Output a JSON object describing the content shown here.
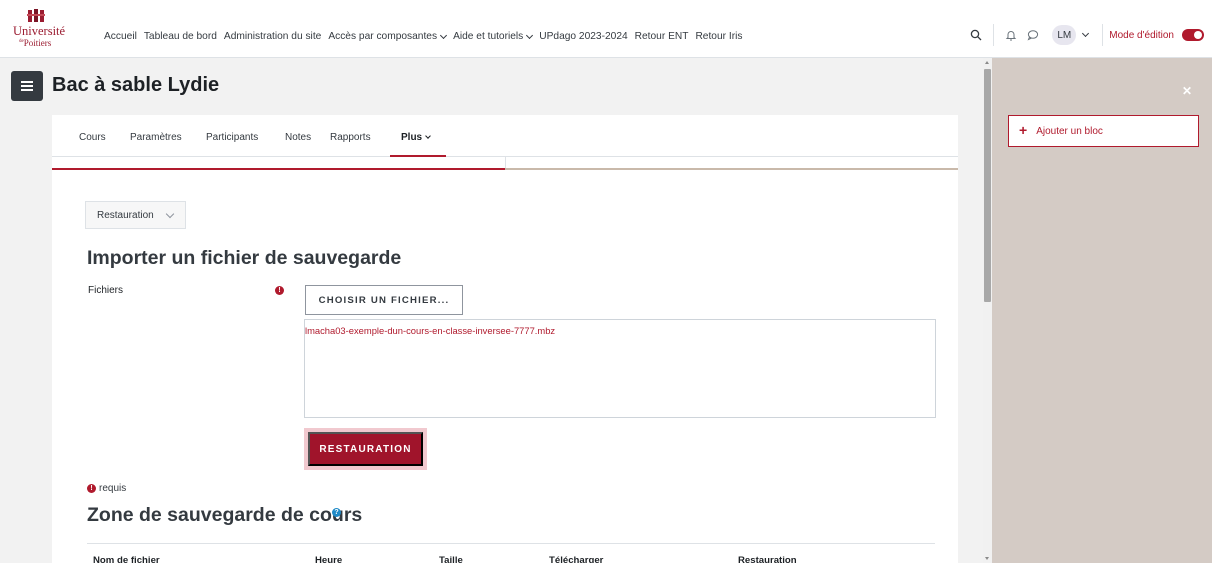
{
  "logo": {
    "line1": "Université",
    "line2": "Poitiers",
    "line2_prefix": "de"
  },
  "nav": {
    "items": [
      {
        "label": "Accueil",
        "dropdown": false
      },
      {
        "label": "Tableau de bord",
        "dropdown": false
      },
      {
        "label": "Administration du site",
        "dropdown": false
      },
      {
        "label": "Accès par composantes",
        "dropdown": true
      },
      {
        "label": "Aide et tutoriels",
        "dropdown": true
      },
      {
        "label": "UPdago 2023-2024",
        "dropdown": false
      },
      {
        "label": "Retour ENT",
        "dropdown": false
      },
      {
        "label": "Retour Iris",
        "dropdown": false
      }
    ],
    "user_initials": "LM",
    "edit_mode_label": "Mode d'édition",
    "icons": [
      "search-icon",
      "bell-icon",
      "chat-icon"
    ]
  },
  "page": {
    "title": "Bac à sable Lydie"
  },
  "tabs": {
    "items": [
      "Cours",
      "Paramètres",
      "Participants",
      "Notes",
      "Rapports",
      "Plus"
    ],
    "active": "Plus"
  },
  "restore": {
    "select_value": "Restauration",
    "import_heading": "Importer un fichier de sauvegarde",
    "files_label": "Fichiers",
    "choose_button": "CHOISIR UN FICHIER...",
    "filename": "lmacha03-exemple-dun-cours-en-classe-inversee-7777.mbz",
    "restore_button": "RESTAURATION",
    "required_text": "requis",
    "required_icon": "!",
    "help_icon": "?"
  },
  "backup_zone": {
    "heading": "Zone de sauvegarde de cours",
    "columns": [
      "Nom de fichier",
      "Heure",
      "Taille",
      "Télécharger",
      "Restauration"
    ]
  },
  "drawer": {
    "add_block_label": "Ajouter un bloc",
    "close_icon": "close-icon"
  },
  "colors": {
    "accent": "#b01a2d",
    "drawer_bg": "#d4cbc5",
    "page_bg": "#f2f2f2"
  }
}
